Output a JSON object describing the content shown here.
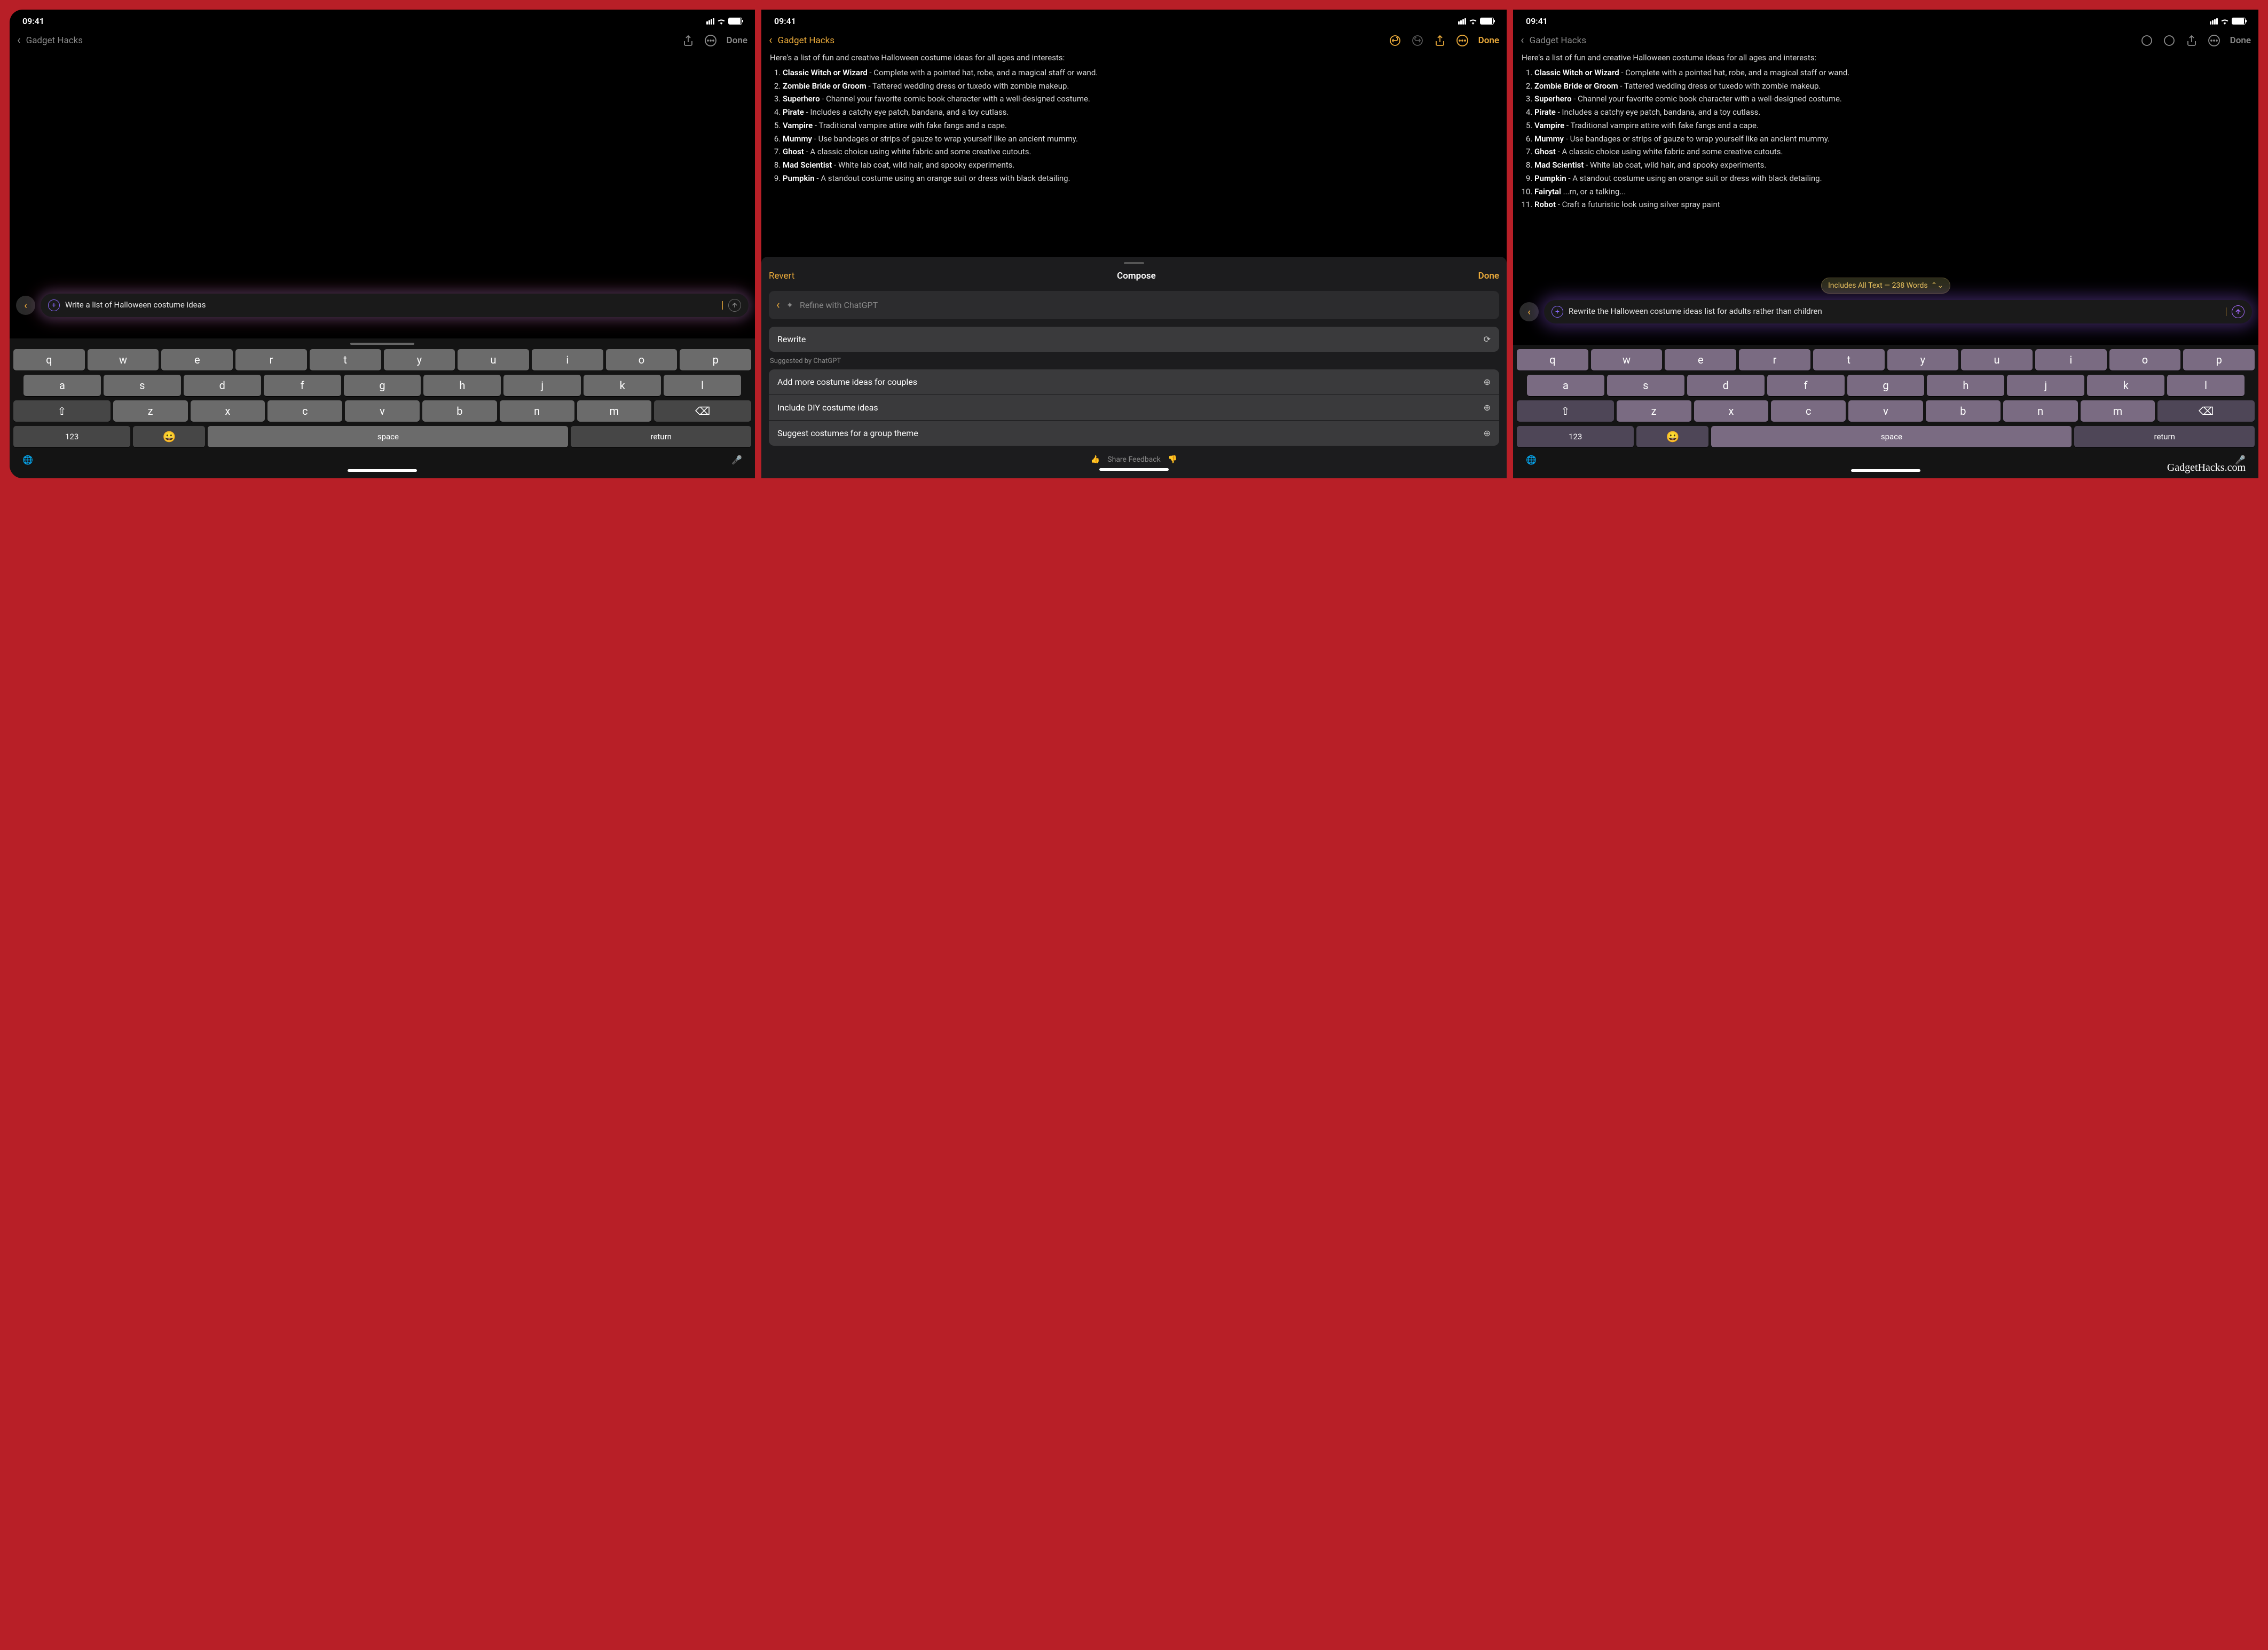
{
  "status": {
    "time": "09:41"
  },
  "nav": {
    "back_label": "Gadget Hacks",
    "done": "Done"
  },
  "screen1": {
    "prompt": "Write a list of Halloween costume ideas"
  },
  "screen2": {
    "sheet": {
      "revert": "Revert",
      "title": "Compose",
      "done": "Done",
      "refine_placeholder": "Refine with ChatGPT",
      "rewrite": "Rewrite",
      "suggested_label": "Suggested by ChatGPT",
      "suggestions": [
        "Add more costume ideas for couples",
        "Include DIY costume ideas",
        "Suggest costumes for a group theme"
      ],
      "feedback": "Share Feedback"
    }
  },
  "screen3": {
    "context_pill": "Includes All Text — 238 Words",
    "prompt": "Rewrite the Halloween costume ideas list for adults rather than children"
  },
  "note": {
    "intro": "Here's a list of fun and creative Halloween costume ideas for all ages and interests:",
    "items": [
      {
        "title": "Classic Witch or Wizard",
        "desc": " - Complete with a pointed hat, robe, and a magical staff or wand."
      },
      {
        "title": "Zombie Bride or Groom",
        "desc": " - Tattered wedding dress or tuxedo with zombie makeup."
      },
      {
        "title": "Superhero",
        "desc": " - Channel your favorite comic book character with a well-designed costume."
      },
      {
        "title": "Pirate",
        "desc": " - Includes a catchy eye patch, bandana, and a toy cutlass."
      },
      {
        "title": "Vampire",
        "desc": " - Traditional vampire attire with fake fangs and a cape."
      },
      {
        "title": "Mummy",
        "desc": " - Use bandages or strips of gauze to wrap yourself like an ancient mummy."
      },
      {
        "title": "Ghost",
        "desc": " - A classic choice using white fabric and some creative cutouts."
      },
      {
        "title": "Mad Scientist",
        "desc": " - White lab coat, wild hair, and spooky experiments."
      },
      {
        "title": "Pumpkin",
        "desc": " - A standout costume using an orange suit or dress with black detailing."
      },
      {
        "title": "Fairytal",
        "desc": " ...rn, or a talking..."
      },
      {
        "title": "Robot",
        "desc": " - Craft a futuristic look using silver spray paint"
      }
    ]
  },
  "keyboard": {
    "row1": [
      "q",
      "w",
      "e",
      "r",
      "t",
      "y",
      "u",
      "i",
      "o",
      "p"
    ],
    "row2": [
      "a",
      "s",
      "d",
      "f",
      "g",
      "h",
      "j",
      "k",
      "l"
    ],
    "row3": [
      "z",
      "x",
      "c",
      "v",
      "b",
      "n",
      "m"
    ],
    "numbers": "123",
    "space": "space",
    "return": "return"
  },
  "watermark": "GadgetHacks.com"
}
